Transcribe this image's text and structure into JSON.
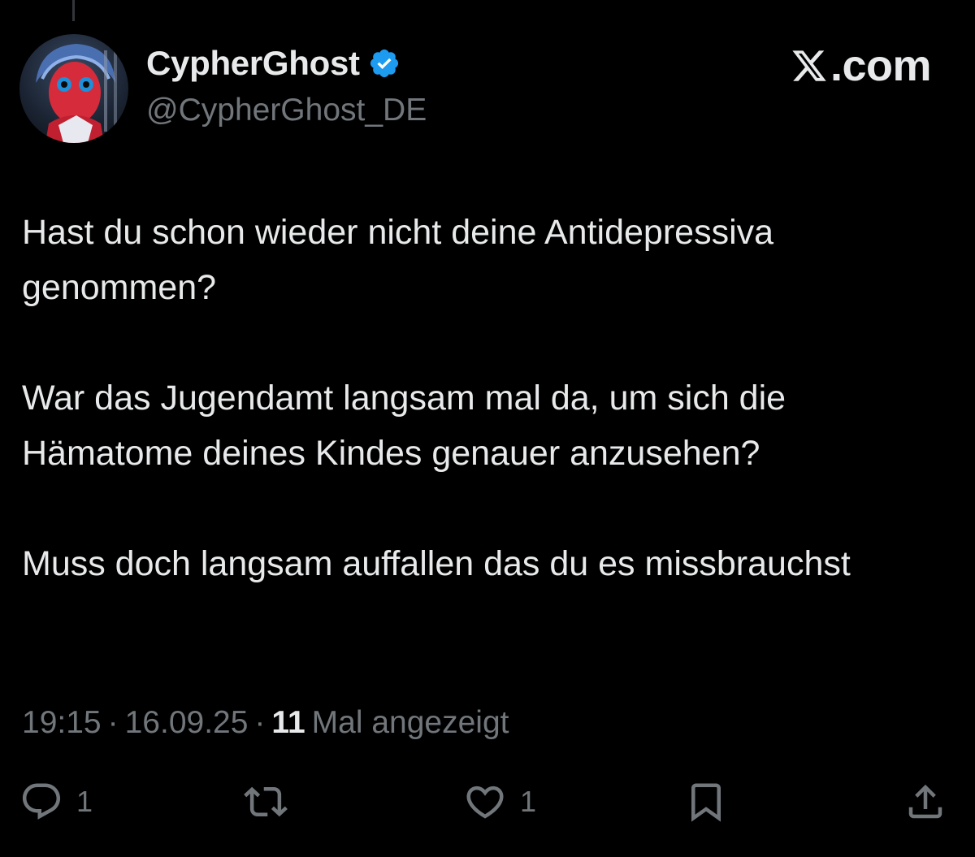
{
  "author": {
    "display_name": "CypherGhost",
    "handle": "@CypherGhost_DE"
  },
  "brand": {
    "text": ".com"
  },
  "tweet": {
    "paragraphs": [
      "Hast du schon wieder nicht deine Antidepressiva genommen?",
      "War das Jugendamt langsam mal da, um sich die Hämatome deines Kindes genauer anzusehen?",
      "Muss doch langsam auffallen das du es missbrauchst"
    ]
  },
  "meta": {
    "time": "19:15",
    "sep1": "·",
    "date": "16.09.25",
    "sep2": "·",
    "views_count": "11",
    "views_label": "Mal angezeigt"
  },
  "actions": {
    "reply_count": "1",
    "like_count": "1"
  },
  "colors": {
    "background": "#000000",
    "text": "#e7e9ea",
    "muted": "#71767b",
    "verified": "#1d9bf0"
  }
}
